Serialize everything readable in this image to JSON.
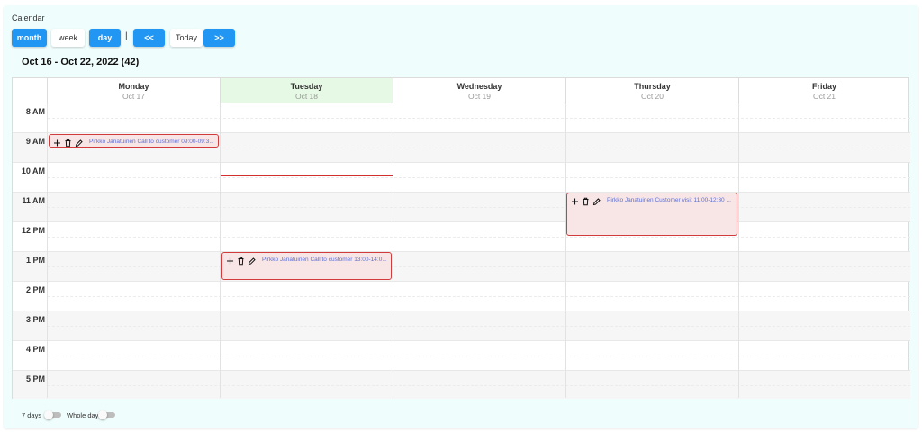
{
  "app_title": "Calendar",
  "toolbar": {
    "month_label": "month",
    "week_label": "week",
    "day_label": "day",
    "separator": "|",
    "prev_label": "<<",
    "today_label": "Today",
    "next_label": ">>"
  },
  "range_title": "Oct 16 - Oct 22, 2022 (42)",
  "days": [
    {
      "name": "Monday",
      "date": "Oct 17"
    },
    {
      "name": "Tuesday",
      "date": "Oct 18"
    },
    {
      "name": "Wednesday",
      "date": "Oct 19"
    },
    {
      "name": "Thursday",
      "date": "Oct 20"
    },
    {
      "name": "Friday",
      "date": "Oct 21"
    }
  ],
  "hours": [
    "8 AM",
    "9 AM",
    "10 AM",
    "11 AM",
    "12 PM",
    "1 PM",
    "2 PM",
    "3 PM",
    "4 PM",
    "5 PM"
  ],
  "events": [
    {
      "text": "Pirkko Janatuinen Call to customer 09:00-09:3...",
      "icons": [
        "plus-icon",
        "trash-icon",
        "pencil-icon"
      ]
    },
    {
      "text": "Pirkko Janatuinen Call to customer 13:00-14:0...",
      "icons": [
        "plus-icon",
        "trash-icon",
        "pencil-icon"
      ]
    },
    {
      "text": "Pirkko Janatuinen Customer visit 11:00-12:30 ...",
      "icons": [
        "plus-icon",
        "trash-icon",
        "pencil-icon"
      ]
    }
  ],
  "footer": {
    "seven_days_label": "7 days",
    "whole_day_label": "Whole day"
  },
  "colors": {
    "accent": "#2196f3",
    "today_header": "#e6f9e4",
    "event_bg": "#f8e6e6",
    "event_border": "#d13b3b",
    "event_text": "#5b6fd6",
    "now_line": "#d32f2f",
    "panel_bg": "#effdfc"
  }
}
